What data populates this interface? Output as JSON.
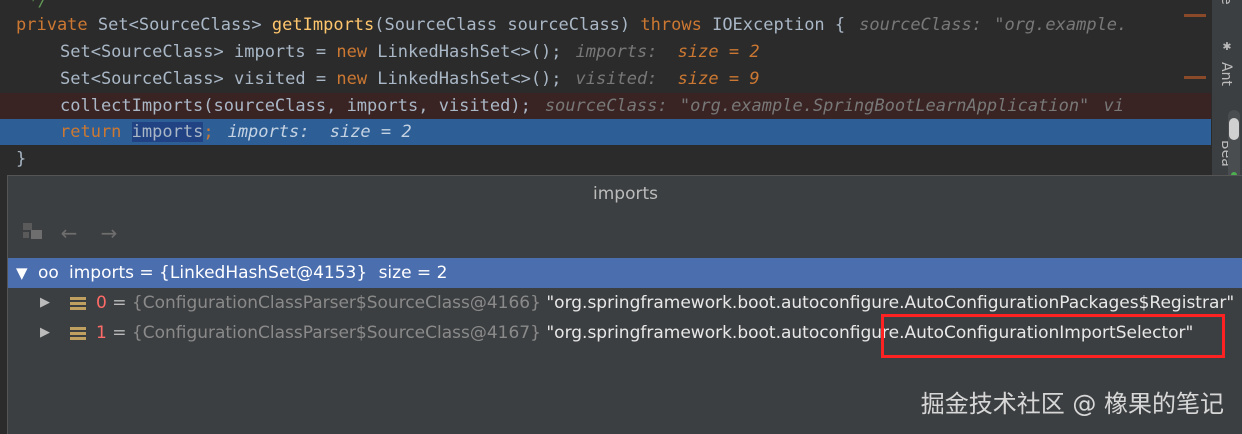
{
  "editor": {
    "line0": {
      "comment": "*/"
    },
    "line1": {
      "kw_private": "private",
      "type": "Set<SourceClass>",
      "method": "getImports",
      "params": "(SourceClass sourceClass)",
      "kw_throws": "throws",
      "exception": "IOException {",
      "hint_name": "sourceClass:",
      "hint_value": "\"org.example."
    },
    "line2": {
      "decl": "Set<SourceClass> imports = ",
      "kw_new": "new",
      "init": " LinkedHashSet<>();",
      "hint_name": "imports:",
      "hint_value": "size = 2"
    },
    "line3": {
      "decl": "Set<SourceClass> visited = ",
      "kw_new": "new",
      "init": " LinkedHashSet<>();",
      "hint_name": "visited:",
      "hint_value": "size = 9"
    },
    "line4": {
      "code": "collectImports(sourceClass, imports, visited);",
      "hint_name": "sourceClass:",
      "hint_value": "\"org.example.SpringBootLearnApplication\"",
      "hint_tail": "vi"
    },
    "line5": {
      "kw_return": "return",
      "var": "imports",
      "semi": ";",
      "hint_name": "imports:",
      "hint_value": "size = 2"
    },
    "line6": {
      "brace": "}"
    }
  },
  "tool_strip": {
    "top_label": "e",
    "ant_label": "Ant",
    "bottom_label": "Bea"
  },
  "popup": {
    "title": "imports",
    "toolbar": {
      "icon_names": [
        "hierarchy-icon",
        "back-arrow-icon",
        "forward-arrow-icon"
      ]
    },
    "root": {
      "name": "imports",
      "value": "= {LinkedHashSet@4153}",
      "size": "size = 2"
    },
    "items": [
      {
        "index": "0",
        "eq": "=",
        "object": "{ConfigurationClassParser$SourceClass@4166}",
        "string": "\"org.springframework.boot.autoconfigure.AutoConfigurationPackages$Registrar\""
      },
      {
        "index": "1",
        "eq": "=",
        "object": "{ConfigurationClassParser$SourceClass@4167}",
        "string": "\"org.springframework.boot.autoconfigure.AutoConfigurationImportSelector\""
      }
    ]
  },
  "watermark": "掘金技术社区 @ 橡果的笔记",
  "colors": {
    "editor_bg": "#2b2b2b",
    "execution_line": "#2d5f96",
    "selected_row": "#4b6eaf",
    "highlight_box": "#ff2222"
  }
}
